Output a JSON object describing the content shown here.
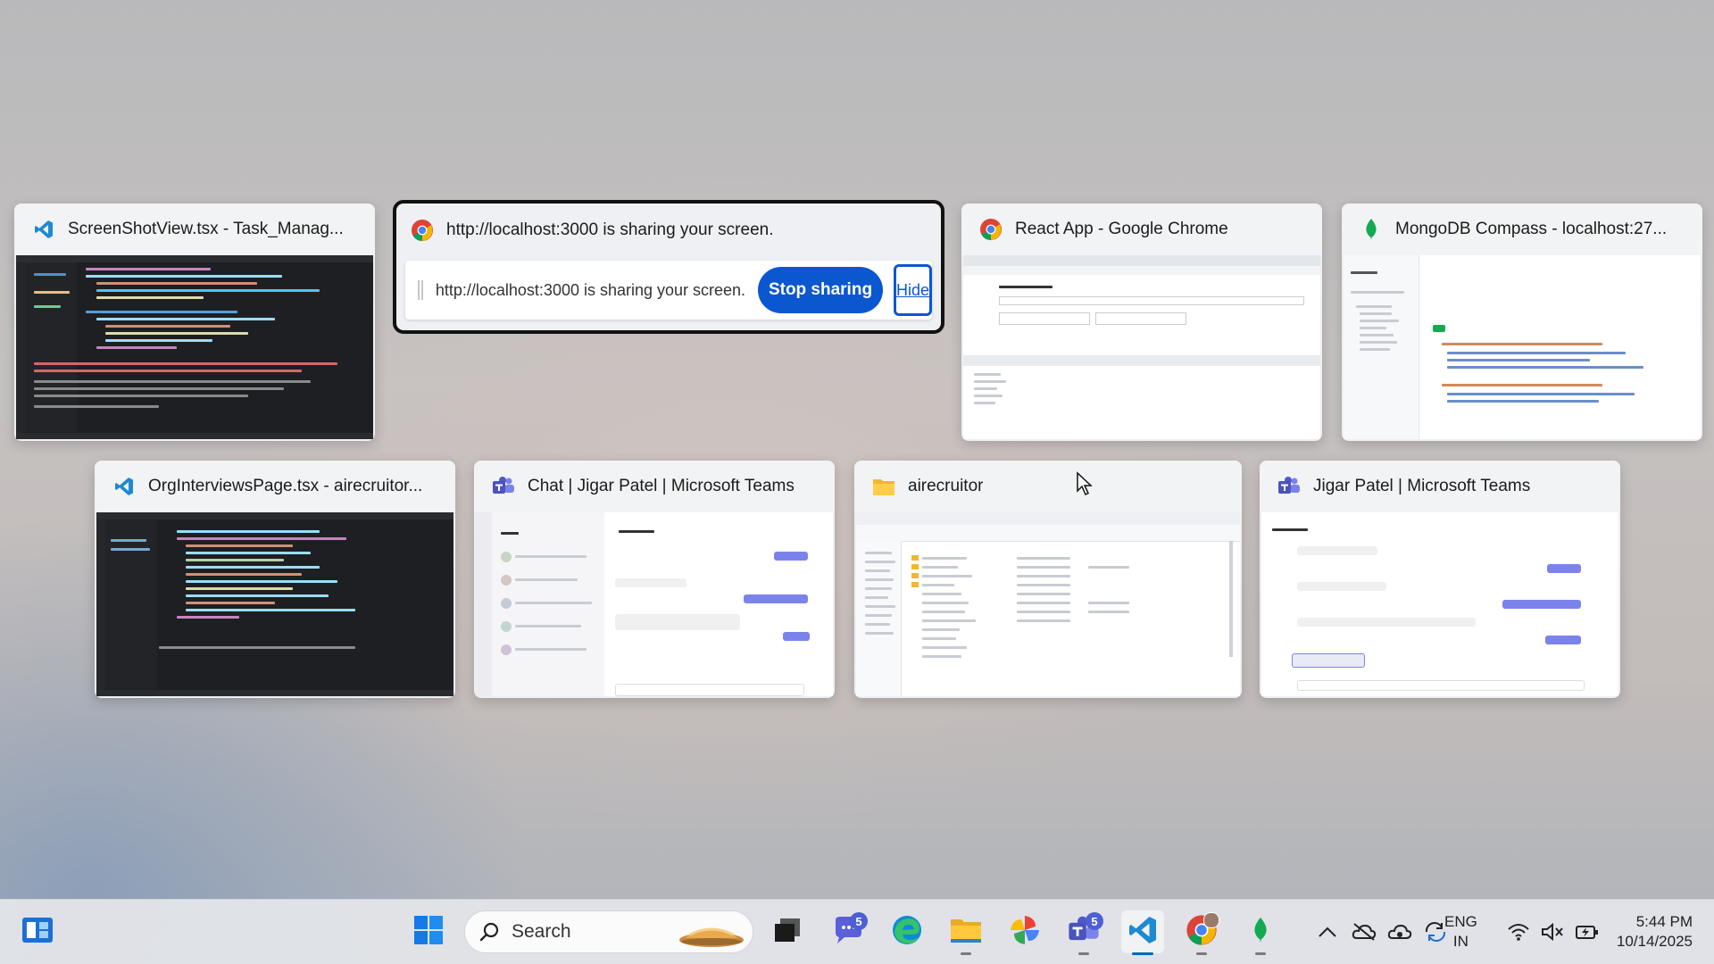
{
  "task_view": {
    "windows": [
      {
        "title": "ScreenShotView.tsx - Task_Manag...",
        "icon": "vscode-icon"
      },
      {
        "title": "http://localhost:3000 is sharing your screen.",
        "icon": "chrome-icon"
      },
      {
        "title": "React App - Google Chrome",
        "icon": "chrome-icon"
      },
      {
        "title": "MongoDB Compass - localhost:27...",
        "icon": "mongodb-icon"
      },
      {
        "title": "OrgInterviewsPage.tsx - airecruitor...",
        "icon": "vscode-icon"
      },
      {
        "title": "Chat | Jigar Patel | Microsoft Teams",
        "icon": "teams-icon"
      },
      {
        "title": "airecruitor",
        "icon": "folder-icon"
      },
      {
        "title": "Jigar Patel | Microsoft Teams",
        "icon": "teams-icon"
      }
    ],
    "share_bar": {
      "message": "http://localhost:3000 is sharing your screen.",
      "stop_label": "Stop sharing",
      "hide_label": "Hide"
    }
  },
  "taskbar": {
    "search_label": "Search",
    "pinned": [
      {
        "name": "start-button",
        "icon": "windows-logo-icon"
      },
      {
        "name": "task-view-button",
        "icon": "task-view-icon"
      },
      {
        "name": "teams-chat-button",
        "icon": "teams-chat-icon",
        "badge": "5"
      },
      {
        "name": "edge-button",
        "icon": "edge-icon"
      },
      {
        "name": "file-explorer-button",
        "icon": "folder-icon"
      },
      {
        "name": "photos-button",
        "icon": "pinwheel-icon"
      },
      {
        "name": "teams-button",
        "icon": "teams-icon",
        "badge": "5"
      },
      {
        "name": "vscode-button",
        "icon": "vscode-icon"
      },
      {
        "name": "chrome-button",
        "icon": "chrome-icon"
      },
      {
        "name": "mongodb-button",
        "icon": "mongodb-icon"
      }
    ],
    "tray": {
      "language_line1": "ENG",
      "language_line2": "IN",
      "time": "5:44 PM",
      "date": "10/14/2025"
    },
    "colors": {
      "accent": "#0067c0",
      "stop_button": "#0b57d0",
      "badge": "#4c5fd5"
    }
  }
}
